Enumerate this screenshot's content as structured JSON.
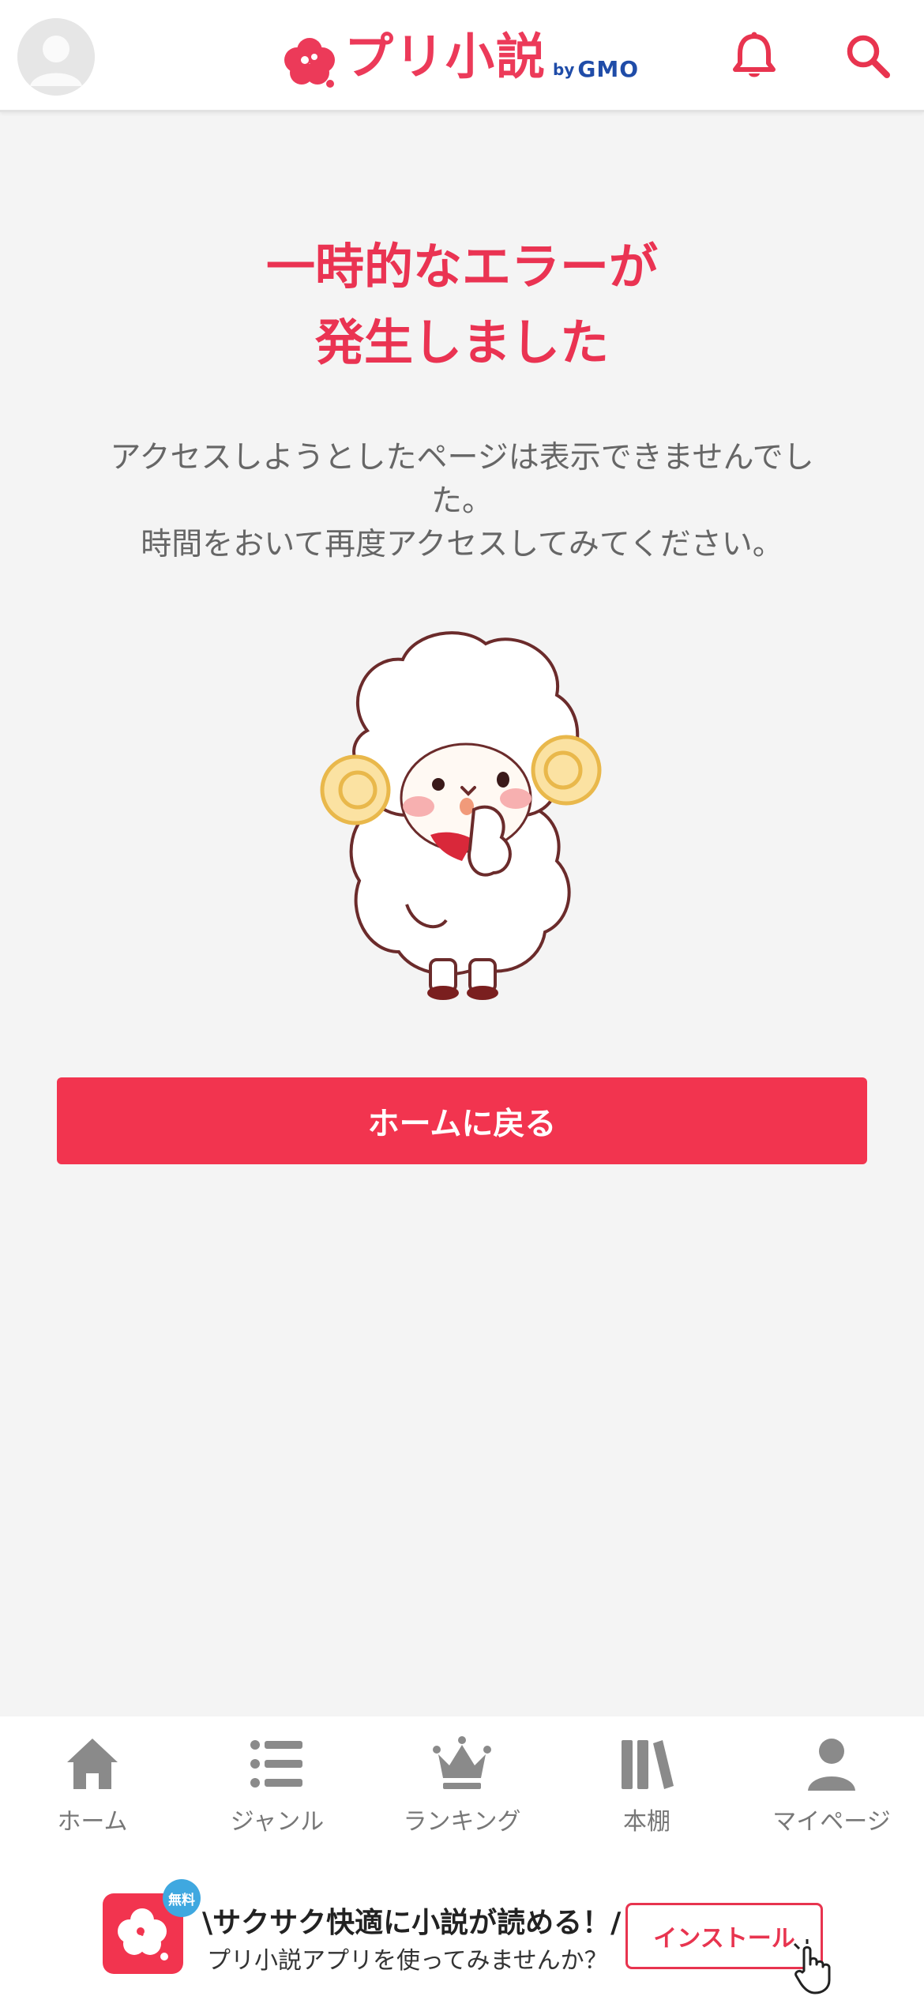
{
  "header": {
    "logo_text": "プリ小説",
    "logo_by": "by",
    "logo_gmo": "GMO"
  },
  "error": {
    "title_line1": "一時的なエラーが",
    "title_line2": "発生しました",
    "message_line1": "アクセスしようとしたページは表示できませんでし",
    "message_line2": "た。",
    "message_line3": "時間をおいて再度アクセスしてみてください。"
  },
  "home_button": {
    "label": "ホームに戻る"
  },
  "bottom_nav": {
    "items": [
      {
        "label": "ホーム",
        "icon": "home-icon"
      },
      {
        "label": "ジャンル",
        "icon": "list-icon"
      },
      {
        "label": "ランキング",
        "icon": "crown-icon"
      },
      {
        "label": "本棚",
        "icon": "bookshelf-icon"
      },
      {
        "label": "マイページ",
        "icon": "person-icon"
      }
    ]
  },
  "banner": {
    "badge": "無料",
    "headline": "\\サクサク快適に小説が読める！/",
    "sub": "プリ小説アプリを使ってみませんか？",
    "install_label": "インストール"
  },
  "colors": {
    "accent": "#ea3352",
    "button": "#f2344f",
    "background": "#f4f4f4",
    "gmo_blue": "#1f4ca8"
  }
}
